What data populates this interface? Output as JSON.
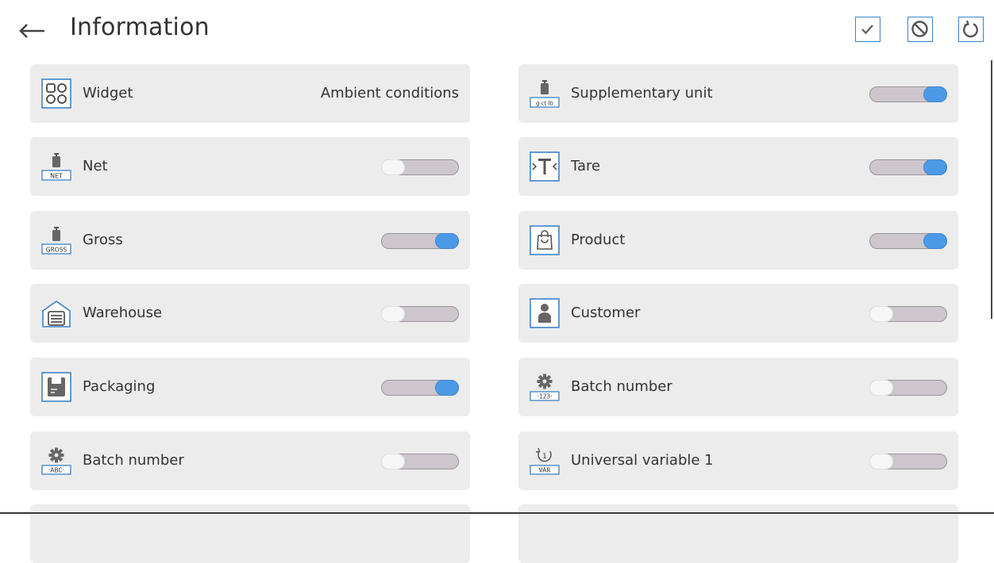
{
  "header": {
    "title": "Information",
    "back_icon": "back-arrow-icon",
    "buttons": [
      {
        "name": "confirm-button",
        "icon": "checkmark-icon"
      },
      {
        "name": "cancel-button",
        "icon": "cancel-icon"
      },
      {
        "name": "reset-button",
        "icon": "reset-icon"
      }
    ]
  },
  "colors": {
    "accent": "#3c83c9",
    "toggle_on": "#4c9ae6",
    "toggle_track": "#cdc7cd",
    "tile_bg": "#ececec"
  },
  "left_column": [
    {
      "label": "Widget",
      "icon": "widget-grid-icon",
      "value": "Ambient conditions"
    },
    {
      "label": "Net",
      "icon": "net-weight-icon",
      "icon_text": "NET",
      "toggle": false
    },
    {
      "label": "Gross",
      "icon": "gross-weight-icon",
      "icon_text": "GROSS",
      "toggle": true
    },
    {
      "label": "Warehouse",
      "icon": "warehouse-icon",
      "toggle": false
    },
    {
      "label": "Packaging",
      "icon": "packaging-icon",
      "toggle": true
    },
    {
      "label": "Batch number",
      "icon": "batch-number-abc-icon",
      "icon_text": "·ABC·",
      "toggle": false
    }
  ],
  "right_column": [
    {
      "label": "Supplementary unit",
      "icon": "supplementary-unit-icon",
      "icon_text": "g·ct·lb",
      "toggle": true
    },
    {
      "label": "Tare",
      "icon": "tare-icon",
      "toggle": true
    },
    {
      "label": "Product",
      "icon": "product-icon",
      "toggle": true
    },
    {
      "label": "Customer",
      "icon": "customer-icon",
      "toggle": false
    },
    {
      "label": "Batch number",
      "icon": "batch-number-123-icon",
      "icon_text": "·123·",
      "toggle": false
    },
    {
      "label": "Universal variable 1",
      "icon": "universal-variable-icon",
      "icon_text": "VAR",
      "icon_digit": "1",
      "toggle": false
    }
  ]
}
